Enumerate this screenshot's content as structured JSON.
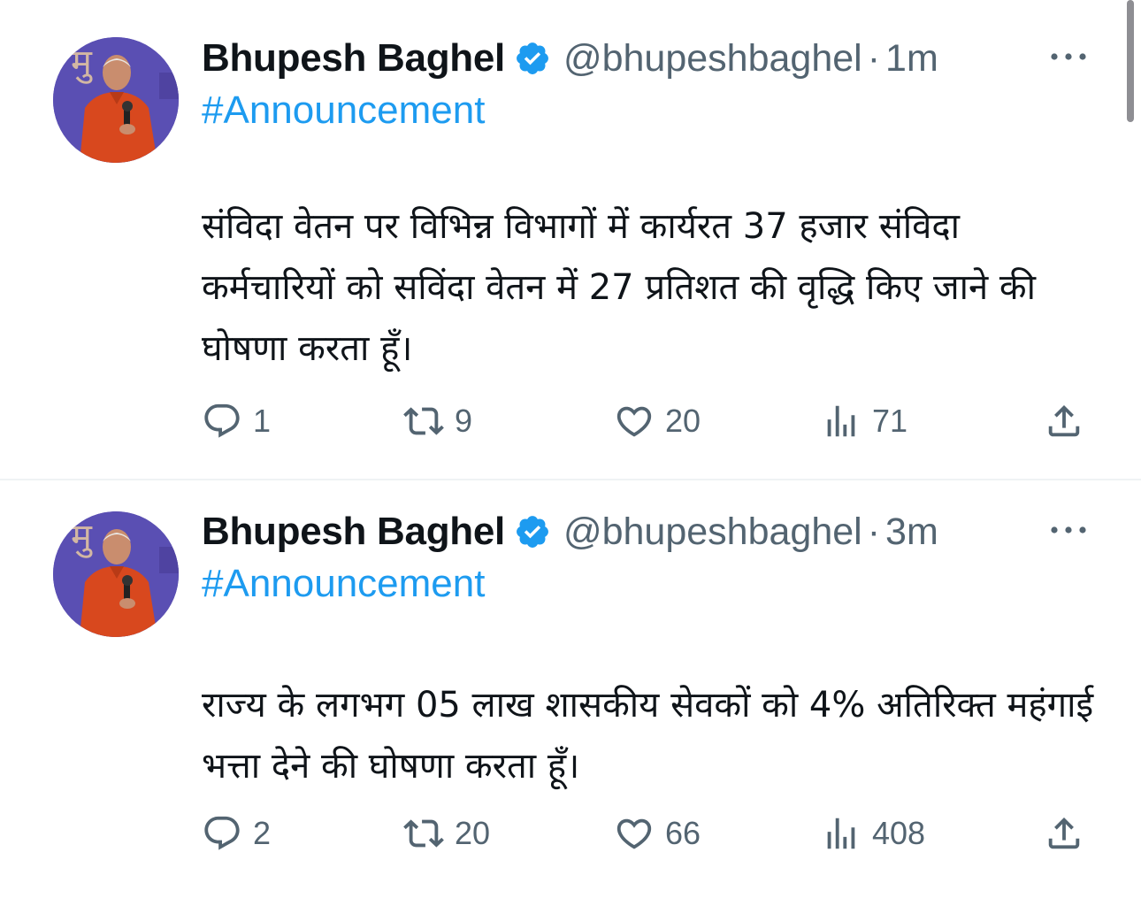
{
  "tweets": [
    {
      "author_name": "Bhupesh Baghel",
      "handle": "@bhupeshbaghel",
      "separator": "·",
      "time": "1m",
      "hashtag": "#Announcement",
      "text": "संविदा वेतन पर विभिन्न विभागों में कार्यरत 37 हजार संविदा कर्मचारियों को सविंदा वेतन में 27 प्रतिशत की वृद्धि किए जाने की घोषणा करता हूँ।",
      "replies": "1",
      "retweets": "9",
      "likes": "20",
      "views": "71"
    },
    {
      "author_name": "Bhupesh Baghel",
      "handle": "@bhupeshbaghel",
      "separator": "·",
      "time": "3m",
      "hashtag": "#Announcement",
      "text": "राज्य के लगभग 05 लाख शासकीय सेवकों को 4% अतिरिक्त महंगाई भत्ता देने की घोषणा करता हूँ।",
      "replies": "2",
      "retweets": "20",
      "likes": "66",
      "views": "408"
    }
  ],
  "icons": {
    "verified": "verified-badge-icon",
    "more": "more-horizontal-icon",
    "reply": "reply-icon",
    "retweet": "retweet-icon",
    "like": "heart-icon",
    "views": "views-icon",
    "share": "share-icon"
  },
  "colors": {
    "accent": "#1d9bf0",
    "text_primary": "#0f1419",
    "text_secondary": "#536471",
    "divider": "#eff3f4"
  }
}
